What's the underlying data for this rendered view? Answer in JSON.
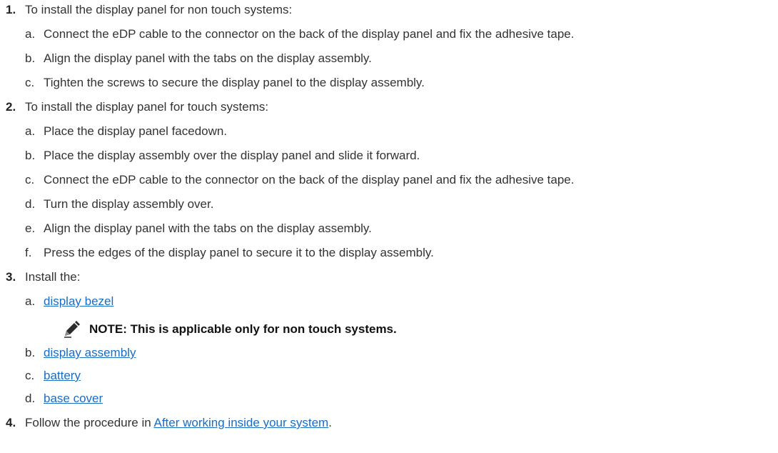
{
  "steps": [
    {
      "number": "1.",
      "text": "To install the display panel for non touch systems:",
      "substeps": [
        {
          "letter": "a.",
          "text": "Connect the eDP cable to the connector on the back of the display panel and fix the adhesive tape."
        },
        {
          "letter": "b.",
          "text": "Align the display panel with the tabs on the display assembly."
        },
        {
          "letter": "c.",
          "text": "Tighten the screws to secure the display panel to the display assembly."
        }
      ]
    },
    {
      "number": "2.",
      "text": "To install the display panel for touch systems:",
      "substeps": [
        {
          "letter": "a.",
          "text": "Place the display panel facedown."
        },
        {
          "letter": "b.",
          "text": "Place the display assembly over the display panel and slide it forward."
        },
        {
          "letter": "c.",
          "text": "Connect the eDP cable to the connector on the back of the display panel and fix the adhesive tape."
        },
        {
          "letter": "d.",
          "text": "Turn the display assembly over."
        },
        {
          "letter": "e.",
          "text": "Align the display panel with the tabs on the display assembly."
        },
        {
          "letter": "f.",
          "text": "Press the edges of the display panel to secure it to the display assembly."
        }
      ]
    },
    {
      "number": "3.",
      "text": "Install the:",
      "substeps": [
        {
          "letter": "a.",
          "link": "display bezel"
        },
        {
          "letter": "b.",
          "link": "display assembly"
        },
        {
          "letter": "c.",
          "link": "battery"
        },
        {
          "letter": "d.",
          "link": "base cover"
        }
      ],
      "note": "NOTE: This is applicable only for non touch systems."
    },
    {
      "number": "4.",
      "text_before": "Follow the procedure in ",
      "link": "After working inside your system",
      "text_after": "."
    }
  ],
  "icons": {
    "note": "pencil-icon"
  }
}
